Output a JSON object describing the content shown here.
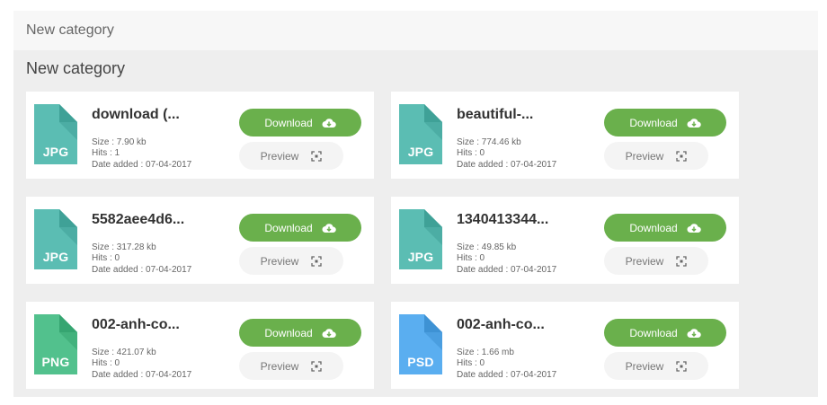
{
  "breadcrumb": {
    "label": "New category"
  },
  "category": {
    "title": "New category"
  },
  "buttons": {
    "download": "Download",
    "preview": "Preview"
  },
  "colors": {
    "jpg": "#5bbdb3",
    "png": "#52c18d",
    "psd": "#5aaef0",
    "download_button": "#6ab04c"
  },
  "files": [
    {
      "name": "download (...",
      "ext": "JPG",
      "size": "Size : 7.90 kb",
      "hits": "Hits : 1",
      "date": "Date added : 07-04-2017",
      "icon": "jpg-file-icon"
    },
    {
      "name": "beautiful-...",
      "ext": "JPG",
      "size": "Size : 774.46 kb",
      "hits": "Hits : 0",
      "date": "Date added : 07-04-2017",
      "icon": "jpg-file-icon"
    },
    {
      "name": "5582aee4d6...",
      "ext": "JPG",
      "size": "Size : 317.28 kb",
      "hits": "Hits : 0",
      "date": "Date added : 07-04-2017",
      "icon": "jpg-file-icon"
    },
    {
      "name": "1340413344...",
      "ext": "JPG",
      "size": "Size : 49.85 kb",
      "hits": "Hits : 0",
      "date": "Date added : 07-04-2017",
      "icon": "jpg-file-icon"
    },
    {
      "name": "002-anh-co...",
      "ext": "PNG",
      "size": "Size : 421.07 kb",
      "hits": "Hits : 0",
      "date": "Date added : 07-04-2017",
      "icon": "png-file-icon"
    },
    {
      "name": "002-anh-co...",
      "ext": "PSD",
      "size": "Size : 1.66 mb",
      "hits": "Hits : 0",
      "date": "Date added : 07-04-2017",
      "icon": "psd-file-icon"
    }
  ]
}
